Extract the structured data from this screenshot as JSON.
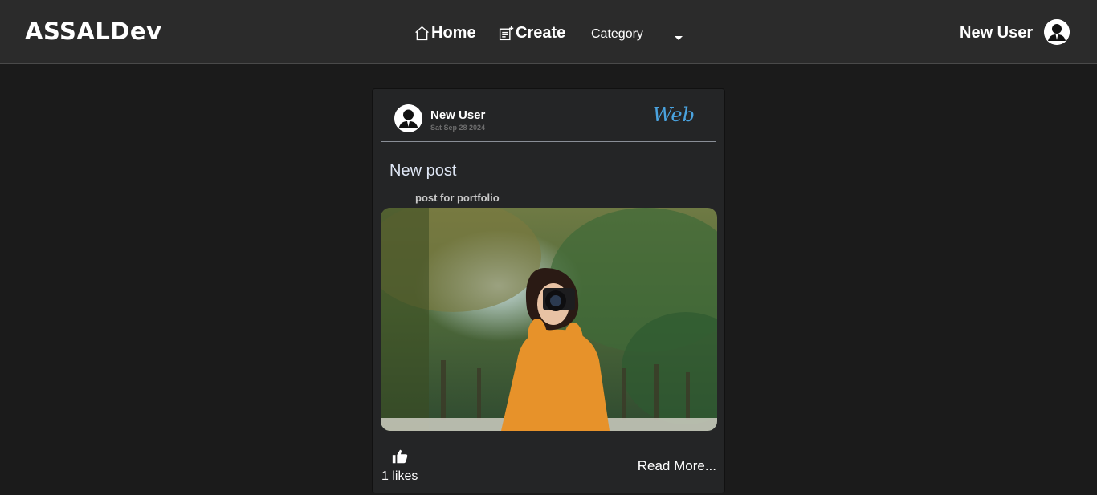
{
  "navbar": {
    "brand": "ASSALDev",
    "home_label": "Home",
    "create_label": "Create",
    "category_label": "Category",
    "user_name": "New User"
  },
  "post": {
    "author": "New User",
    "date": "Sat Sep 28 2024",
    "category": "Web",
    "title": "New post",
    "description": "post for portfolio",
    "likes_text": "1 likes",
    "read_more": "Read More..."
  },
  "icons": {
    "home": "home-icon",
    "create": "create-icon",
    "dropdown": "caret-down-icon",
    "avatar": "user-avatar-icon",
    "like": "thumbs-up-icon"
  },
  "colors": {
    "background": "#1b1b1b",
    "navbar": "#2b2b2b",
    "card": "#242526",
    "category_accent": "#4aa3df",
    "title_text": "#dfe7f5"
  }
}
